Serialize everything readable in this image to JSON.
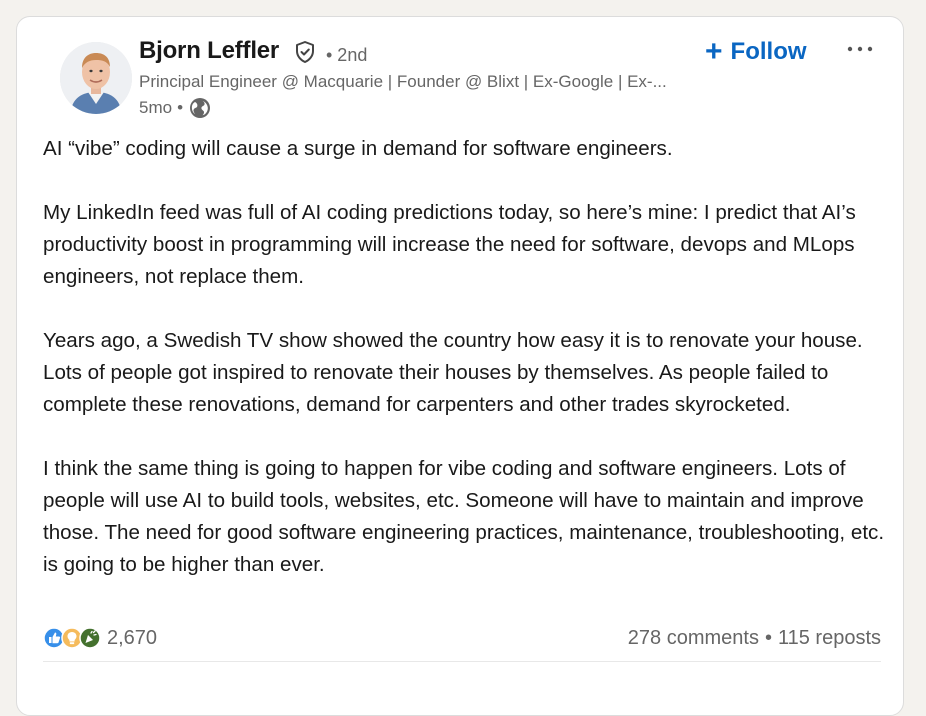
{
  "post": {
    "author": {
      "name": "Bjorn Leffler",
      "degree": "• 2nd",
      "headline": "Principal Engineer @ Macquarie | Founder @ Blixt | Ex-Google | Ex-...",
      "time": "5mo",
      "time_dot": "•",
      "verified_icon": "verified-shield-icon",
      "visibility_icon": "globe-icon"
    },
    "follow_label": "Follow",
    "follow_plus": "+",
    "more_icon": "more-horizontal-icon",
    "paragraphs": [
      "AI “vibe” coding will cause a surge in demand for software engineers.",
      "My LinkedIn feed was full of AI coding predictions today, so here’s mine: I predict that AI’s productivity boost in programming will increase the need for software, devops and MLops engineers, not replace them.",
      "Years ago, a Swedish TV show showed the country how easy it is to renovate your house. Lots of people got inspired to renovate their houses by themselves. As people failed to complete these renovations, demand for carpenters and other trades skyrocketed.",
      "I think the same thing is going to happen for vibe coding and software engineers. Lots of people will use AI to build tools, websites, etc. Someone will have to maintain and improve those. The need for good software engineering practices, maintenance, troubleshooting, etc. is going to be higher than ever."
    ],
    "social": {
      "reaction_icons": [
        "like-icon",
        "insightful-icon",
        "celebrate-icon"
      ],
      "reaction_count": "2,670",
      "comments": "278 comments",
      "separator": "•",
      "reposts": "115 reposts"
    },
    "colors": {
      "accent": "#0a66c2",
      "muted_text": "#666666",
      "like_blue": "#378fe9",
      "insightful_yellow": "#f5bb5c",
      "celebrate_green": "#44712e"
    }
  }
}
